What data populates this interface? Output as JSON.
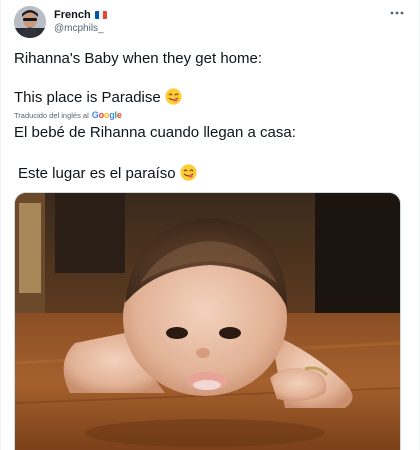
{
  "author": {
    "name": "French",
    "handle": "@mcphils_",
    "flag_colors": [
      "#0055a4",
      "#ffffff",
      "#ef4135"
    ]
  },
  "tweet": {
    "line1": "Rihanna's Baby when they get home:",
    "line2": "This place is Paradise",
    "emoji": "face-savoring-food-icon"
  },
  "translation": {
    "label": "Traducido del inglés al",
    "provider": [
      "G",
      "o",
      "o",
      "g",
      "l",
      "e"
    ],
    "line1": "El bebé de Rihanna cuando llegan a casa:",
    "line2": "Este lugar es el paraíso"
  },
  "media": {
    "description_icon": "baby-licking-floor-photo"
  },
  "colors": {
    "text": "#0f1419",
    "secondary": "#536471",
    "border": "#cfd9de"
  }
}
